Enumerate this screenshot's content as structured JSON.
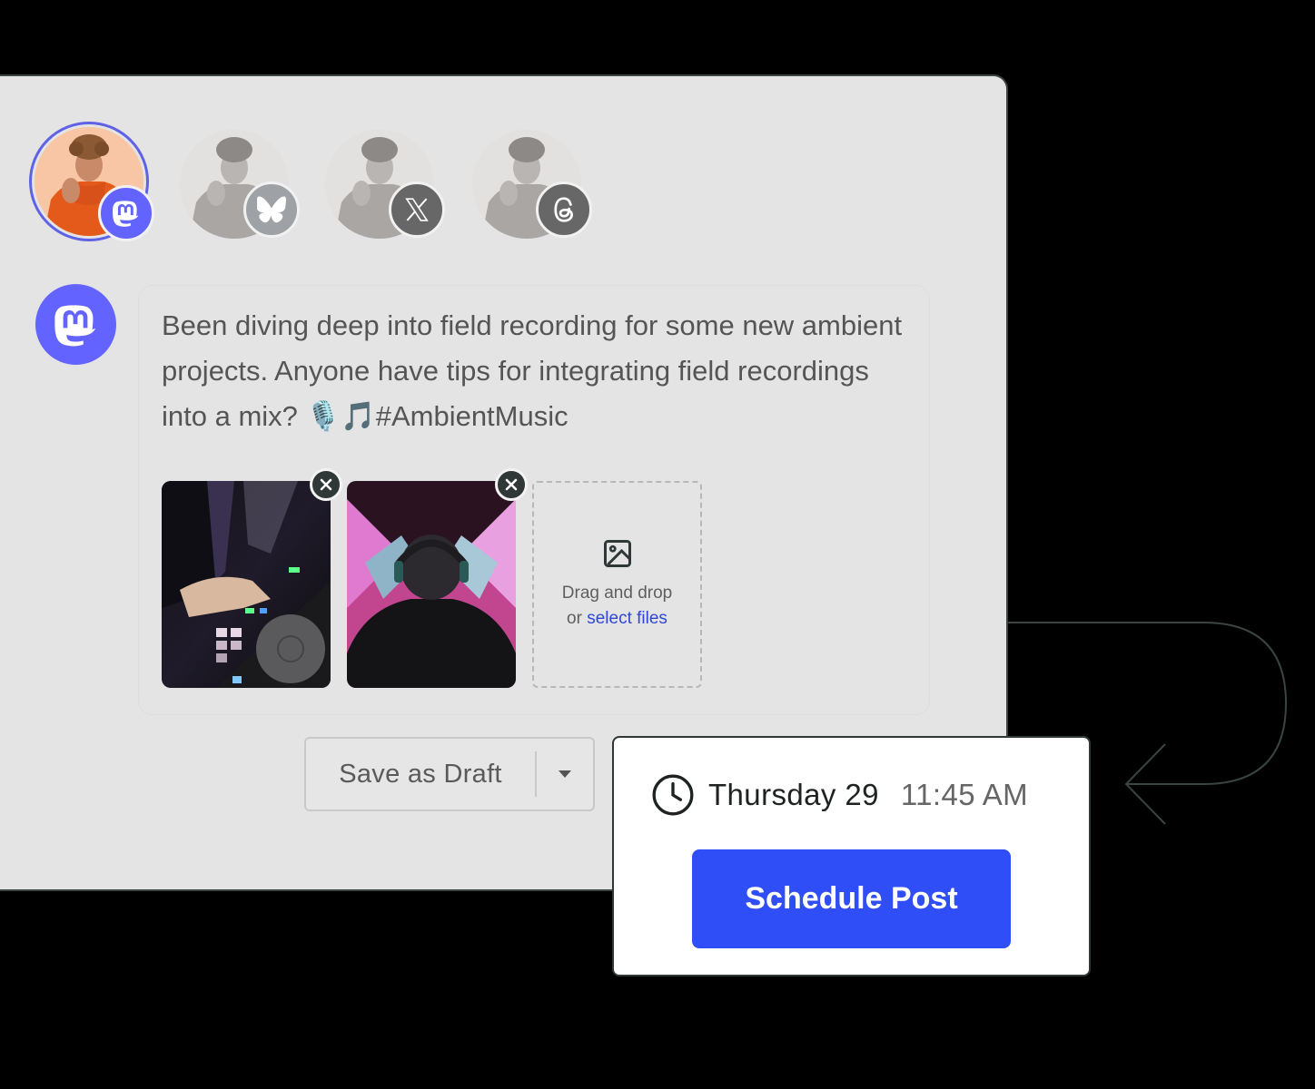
{
  "accounts": [
    {
      "name": "account-mastodon",
      "network": "Mastodon",
      "badge_icon": "mastodon-icon",
      "selected": true,
      "badge_color": "#6364ff"
    },
    {
      "name": "account-bluesky",
      "network": "Bluesky",
      "badge_icon": "butterfly-icon",
      "selected": false,
      "badge_color": "#9a9fa3"
    },
    {
      "name": "account-x",
      "network": "X",
      "badge_icon": "x-logo-icon",
      "selected": false,
      "badge_color": "#6a6a6a"
    },
    {
      "name": "account-threads",
      "network": "Threads",
      "badge_icon": "threads-icon",
      "selected": false,
      "badge_color": "#6a6a6a"
    }
  ],
  "composer": {
    "network_icon": "mastodon-icon",
    "post_text": "Been diving deep into field recording for some new ambient projects. Anyone have tips for integrating field recordings into a mix? 🎙️🎵#AmbientMusic",
    "attachments": [
      {
        "name": "dj-controller-photo",
        "description": "Hands on a DJ controller"
      },
      {
        "name": "headphones-neon-photo",
        "description": "Person with headphones in neon-lit studio"
      }
    ],
    "dropzone": {
      "icon": "image-icon",
      "text": "Drag and drop",
      "or": "or",
      "link": "select files"
    }
  },
  "actions": {
    "save_draft_label": "Save as Draft",
    "dropdown_icon": "caret-down-icon"
  },
  "schedule": {
    "clock_icon": "clock-icon",
    "day": "Thursday 29",
    "time": "11:45 AM",
    "button_label": "Schedule Post"
  },
  "colors": {
    "accent": "#2f4ef7",
    "mastodon": "#6364ff",
    "panel": "#e4e4e4",
    "link": "#2f46d6"
  }
}
